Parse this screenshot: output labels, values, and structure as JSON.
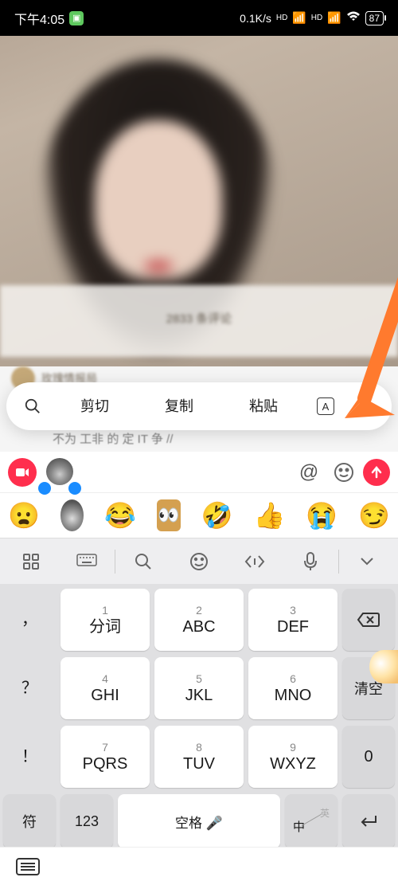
{
  "status_bar": {
    "time": "下午4:05",
    "network_speed": "0.1K/s",
    "hd_label": "HD",
    "battery": "87"
  },
  "video": {
    "caption": "2833 条评论",
    "author": "玫瑰情报局"
  },
  "context_menu": {
    "cut": "剪切",
    "copy": "复制",
    "paste": "粘贴"
  },
  "overflow": "不为 工非 的 定 IT 争 //",
  "keyboard": {
    "keys": {
      "k1": {
        "num": "1",
        "label": "分词"
      },
      "k2": {
        "num": "2",
        "label": "ABC"
      },
      "k3": {
        "num": "3",
        "label": "DEF"
      },
      "k4": {
        "num": "4",
        "label": "GHI"
      },
      "k5": {
        "num": "5",
        "label": "JKL"
      },
      "k6": {
        "num": "6",
        "label": "MNO"
      },
      "k7": {
        "num": "7",
        "label": "PQRS"
      },
      "k8": {
        "num": "8",
        "label": "TUV"
      },
      "k9": {
        "num": "9",
        "label": "WXYZ"
      }
    },
    "side": {
      "comma": "，",
      "question": "？",
      "exclaim": "！",
      "clear": "清空",
      "zero": "0",
      "symbol": "符",
      "num": "123",
      "space": "空格",
      "lang_en": "英",
      "lang_zh": "中",
      "enter": "↵"
    }
  }
}
